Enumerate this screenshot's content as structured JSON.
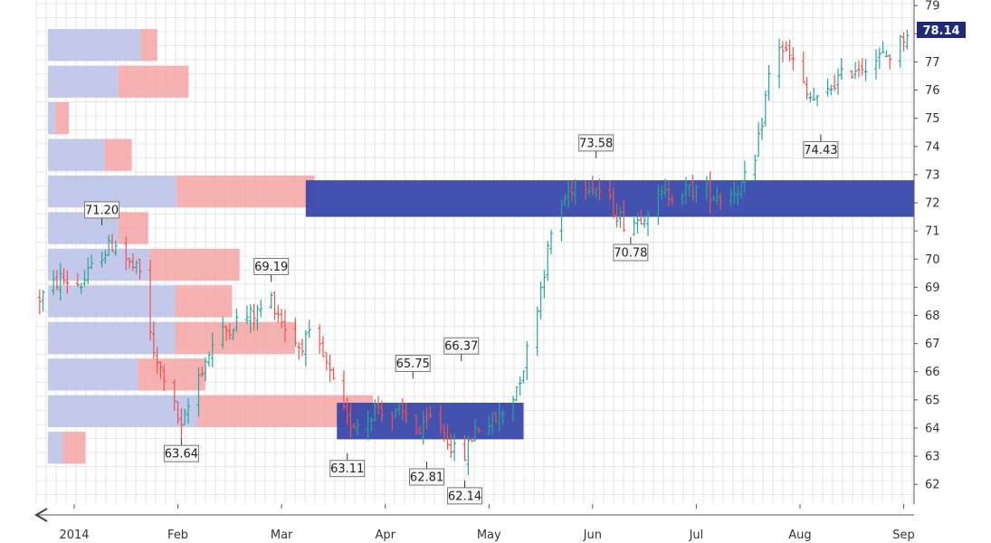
{
  "chart_data": {
    "type": "ohlc",
    "colors": {
      "up": "#26a69a",
      "down": "#ef5350",
      "vp_up": "#b8bfe6",
      "vp_down": "#f5a3a3",
      "value_area": "#3949ab",
      "last_price_bg": "#1f2a7a",
      "grid": "#e0e0e0",
      "axis": "#555555"
    },
    "y_axis": {
      "range": [
        61.3,
        79.2
      ],
      "ticks": [
        62,
        63,
        64,
        65,
        66,
        67,
        68,
        69,
        70,
        71,
        72,
        73,
        74,
        75,
        76,
        77,
        78,
        79
      ]
    },
    "x_axis": {
      "range": [
        "2014-01-01",
        "2014-09-12"
      ],
      "ticks": [
        {
          "label": "2014",
          "date": "2014-01-12"
        },
        {
          "label": "Feb",
          "date": "2014-02-11"
        },
        {
          "label": "Mar",
          "date": "2014-03-13"
        },
        {
          "label": "Apr",
          "date": "2014-04-12"
        },
        {
          "label": "May",
          "date": "2014-05-12"
        },
        {
          "label": "Jun",
          "date": "2014-06-11"
        },
        {
          "label": "Jul",
          "date": "2014-07-11"
        },
        {
          "label": "Aug",
          "date": "2014-08-10"
        },
        {
          "label": "Sep",
          "date": "2014-09-09"
        }
      ]
    },
    "price_path": [
      [
        "2014-01-02",
        68.6
      ],
      [
        "2014-01-08",
        69.3
      ],
      [
        "2014-01-14",
        69.1
      ],
      [
        "2014-01-20",
        70.2
      ],
      [
        "2014-01-24",
        70.6
      ],
      [
        "2014-01-28",
        69.8
      ],
      [
        "2014-02-01",
        69.4
      ],
      [
        "2014-02-04",
        66.5
      ],
      [
        "2014-02-08",
        65.6
      ],
      [
        "2014-02-12",
        63.9
      ],
      [
        "2014-02-16",
        65.6
      ],
      [
        "2014-02-22",
        67.2
      ],
      [
        "2014-02-28",
        67.8
      ],
      [
        "2014-03-06",
        68.1
      ],
      [
        "2014-03-10",
        68.6
      ],
      [
        "2014-03-14",
        67.6
      ],
      [
        "2014-03-18",
        66.9
      ],
      [
        "2014-03-22",
        67.3
      ],
      [
        "2014-03-26",
        66.2
      ],
      [
        "2014-04-01",
        64.2
      ],
      [
        "2014-04-05",
        64.2
      ],
      [
        "2014-04-10",
        64.8
      ],
      [
        "2014-04-14",
        64.4
      ],
      [
        "2014-04-18",
        64.5
      ],
      [
        "2014-04-22",
        63.8
      ],
      [
        "2014-04-26",
        64.5
      ],
      [
        "2014-05-01",
        63.4
      ],
      [
        "2014-05-04",
        62.7
      ],
      [
        "2014-05-08",
        64.0
      ],
      [
        "2014-05-14",
        64.3
      ],
      [
        "2014-05-18",
        64.8
      ],
      [
        "2014-05-22",
        66.2
      ],
      [
        "2014-05-26",
        68.4
      ],
      [
        "2014-05-31",
        71.5
      ],
      [
        "2014-06-06",
        72.8
      ],
      [
        "2014-06-10",
        72.7
      ],
      [
        "2014-06-14",
        72.3
      ],
      [
        "2014-06-20",
        71.3
      ],
      [
        "2014-06-24",
        71.4
      ],
      [
        "2014-06-30",
        72.2
      ],
      [
        "2014-07-06",
        72.4
      ],
      [
        "2014-07-12",
        72.5
      ],
      [
        "2014-07-18",
        72.2
      ],
      [
        "2014-07-24",
        72.6
      ],
      [
        "2014-07-28",
        73.4
      ],
      [
        "2014-08-01",
        76.5
      ],
      [
        "2014-08-04",
        77.6
      ],
      [
        "2014-08-08",
        77.0
      ],
      [
        "2014-08-12",
        75.8
      ],
      [
        "2014-08-16",
        75.5
      ],
      [
        "2014-08-20",
        76.3
      ],
      [
        "2014-08-26",
        76.8
      ],
      [
        "2014-09-01",
        77.1
      ],
      [
        "2014-09-06",
        77.3
      ],
      [
        "2014-09-10",
        78.1
      ]
    ],
    "price_label_annotations": [
      {
        "text": "71.20",
        "date": "2014-01-20",
        "price": 71.2,
        "position": "above"
      },
      {
        "text": "63.64",
        "date": "2014-02-12",
        "price": 63.64,
        "position": "below"
      },
      {
        "text": "69.19",
        "date": "2014-03-10",
        "price": 69.19,
        "position": "above"
      },
      {
        "text": "63.11",
        "date": "2014-04-01",
        "price": 63.11,
        "position": "below"
      },
      {
        "text": "65.75",
        "date": "2014-04-20",
        "price": 65.75,
        "position": "above"
      },
      {
        "text": "62.81",
        "date": "2014-04-24",
        "price": 62.81,
        "position": "below"
      },
      {
        "text": "66.37",
        "date": "2014-05-04",
        "price": 66.37,
        "position": "above"
      },
      {
        "text": "62.14",
        "date": "2014-05-05",
        "price": 62.14,
        "position": "below"
      },
      {
        "text": "73.58",
        "date": "2014-06-12",
        "price": 73.58,
        "position": "above"
      },
      {
        "text": "70.78",
        "date": "2014-06-22",
        "price": 70.78,
        "position": "below"
      },
      {
        "text": "74.43",
        "date": "2014-08-16",
        "price": 74.43,
        "position": "below"
      },
      {
        "text": "",
        "date": "2014-08-06",
        "price": 79.2,
        "position": "above"
      }
    ],
    "last_price": "78.14",
    "volume_profile": {
      "start_date": "2014-01-01",
      "max_width_days": 47,
      "rows": [
        {
          "price_low": 62.7,
          "price_high": 63.9,
          "up": 10,
          "down": 15
        },
        {
          "price_low": 64.0,
          "price_high": 65.2,
          "up": 100,
          "down": 117
        },
        {
          "price_low": 65.3,
          "price_high": 66.5,
          "up": 60,
          "down": 45
        },
        {
          "price_low": 66.6,
          "price_high": 67.8,
          "up": 85,
          "down": 80
        },
        {
          "price_low": 67.9,
          "price_high": 69.1,
          "up": 85,
          "down": 38
        },
        {
          "price_low": 69.2,
          "price_high": 70.4,
          "up": 68,
          "down": 60
        },
        {
          "price_low": 70.5,
          "price_high": 71.7,
          "up": 47,
          "down": 20
        },
        {
          "price_low": 71.8,
          "price_high": 73.0,
          "up": 86,
          "down": 92
        },
        {
          "price_low": 73.1,
          "price_high": 74.3,
          "up": 38,
          "down": 18
        },
        {
          "price_low": 74.4,
          "price_high": 75.6,
          "up": 5,
          "down": 9
        },
        {
          "price_low": 75.7,
          "price_high": 76.9,
          "up": 47,
          "down": 47
        },
        {
          "price_low": 77.0,
          "price_high": 78.2,
          "up": 62,
          "down": 11
        }
      ]
    },
    "value_areas": [
      {
        "start_date": "2014-03-29",
        "end_date": "2014-05-22",
        "price_low": 63.6,
        "price_high": 64.9
      },
      {
        "start_date": "2014-03-20",
        "end_date": "2014-09-12",
        "price_low": 71.5,
        "price_high": 72.8
      }
    ]
  }
}
